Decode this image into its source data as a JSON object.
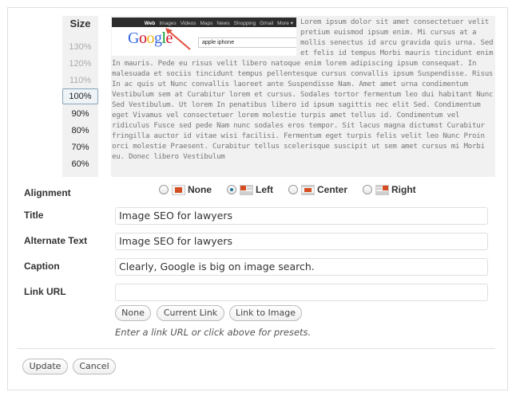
{
  "size": {
    "title": "Size",
    "options": [
      "130%",
      "120%",
      "110%",
      "100%",
      "90%",
      "80%",
      "70%",
      "60%"
    ],
    "selected": "100%"
  },
  "preview": {
    "google_nav": [
      "Web",
      "Images",
      "Videos",
      "Maps",
      "News",
      "Shopping",
      "Gmail",
      "More ▾"
    ],
    "google_logo": "Google",
    "search_query": "apple iphone",
    "lorem": "Lorem ipsum dolor sit amet consectetuer velit pretium euismod ipsum enim. Mi cursus at a mollis senectus id arcu gravida quis urna. Sed et felis id tempus Morbi mauris tincidunt enim In mauris. Pede eu risus velit libero natoque enim lorem adipiscing ipsum consequat. In malesuada et sociis tincidunt tempus pellentesque cursus convallis ipsum Suspendisse. Risus In ac quis ut Nunc convallis laoreet ante Suspendisse Nam. Amet amet urna condimentum Vestibulum sem at Curabitur lorem et cursus. Sodales tortor fermentum leo dui habitant Nunc Sed Vestibulum. Ut lorem In penatibus libero id ipsum sagittis nec elit Sed. Condimentum eget Vivamus vel consectetuer lorem molestie turpis amet tellus id. Condimentum vel ridiculus Fusce sed pede Nam nunc sodales eros tempor. Sit lacus magna dictumst Curabitur fringilla auctor id vitae wisi facilisi. Fermentum eget turpis felis velit leo Nunc Proin orci molestie Praesent. Curabitur tellus scelerisque suscipit ut sem amet cursus mi Morbi eu. Donec libero Vestibulum"
  },
  "alignment": {
    "label": "Alignment",
    "options": [
      "None",
      "Left",
      "Center",
      "Right"
    ],
    "selected": "Left"
  },
  "fields": {
    "title": {
      "label": "Title",
      "value": "Image SEO for lawyers"
    },
    "alt_text": {
      "label": "Alternate Text",
      "value": "Image SEO for lawyers"
    },
    "caption": {
      "label": "Caption",
      "value": "Clearly, Google is big on image search."
    },
    "link_url": {
      "label": "Link URL",
      "value": ""
    }
  },
  "link_buttons": [
    "None",
    "Current Link",
    "Link to Image"
  ],
  "link_hint": "Enter a link URL or click above for presets.",
  "actions": {
    "update": "Update",
    "cancel": "Cancel"
  },
  "colors": {
    "accent": "#21759b",
    "google_bar": "#2d2d2d",
    "align_icon_red": "#d54e21"
  }
}
